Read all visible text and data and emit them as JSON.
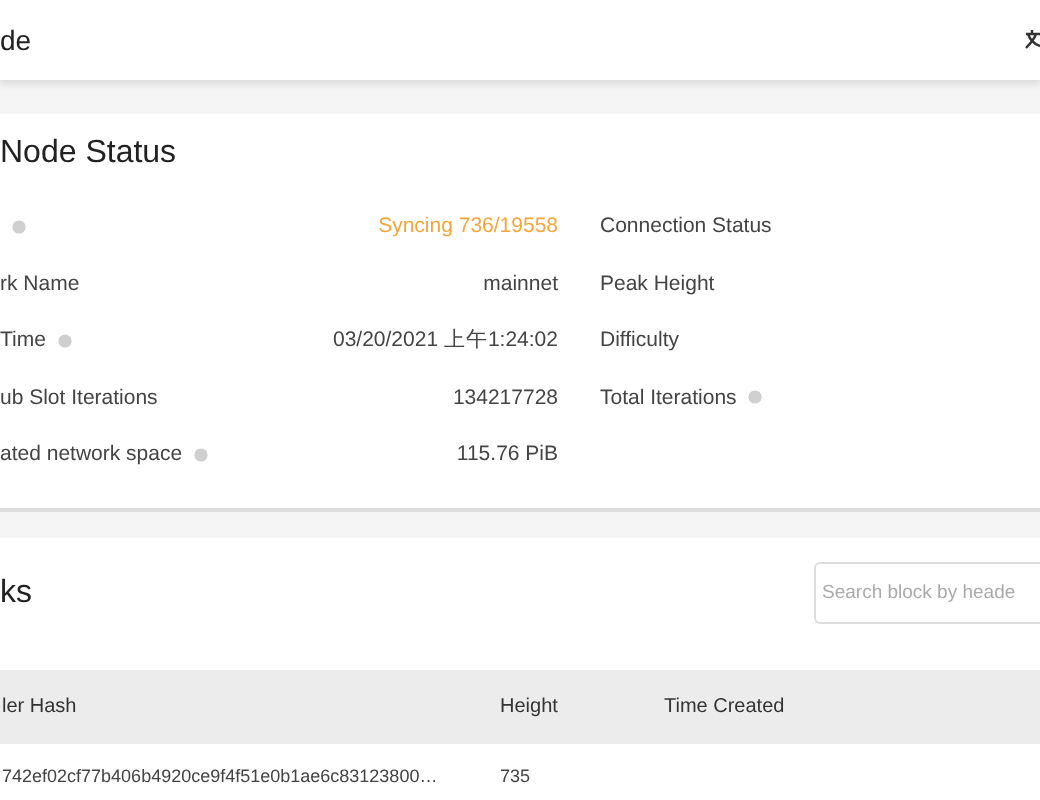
{
  "app_bar": {
    "title": "de",
    "translate_icon": true
  },
  "node_status": {
    "title": "Node Status",
    "left_rows": [
      {
        "label": "",
        "help": true,
        "value": "Syncing 736/19558",
        "kind": "warning"
      },
      {
        "label": "rk Name",
        "help": false,
        "value": "mainnet",
        "kind": "plain"
      },
      {
        "label": "Time",
        "help": true,
        "value": "03/20/2021 上午1:24:02",
        "kind": "plain"
      },
      {
        "label": "ub Slot Iterations",
        "help": false,
        "value": "134217728",
        "kind": "plain"
      },
      {
        "label": "ated network space",
        "help": true,
        "value": "115.76 PiB",
        "kind": "plain"
      }
    ],
    "right_rows": [
      {
        "label": "Connection Status",
        "help": false
      },
      {
        "label": "Peak Height",
        "help": false
      },
      {
        "label": "Difficulty",
        "help": false
      },
      {
        "label": "Total Iterations",
        "help": true
      }
    ]
  },
  "blocks": {
    "title": "ks",
    "search": {
      "placeholder": "Search block by heade"
    },
    "table": {
      "columns": [
        "ler Hash",
        "Height",
        "Time Created"
      ],
      "rows": [
        [
          "742ef02cf77b406b4920ce9f4f51e0b1ae6c83123800…",
          "735",
          ""
        ]
      ]
    }
  }
}
